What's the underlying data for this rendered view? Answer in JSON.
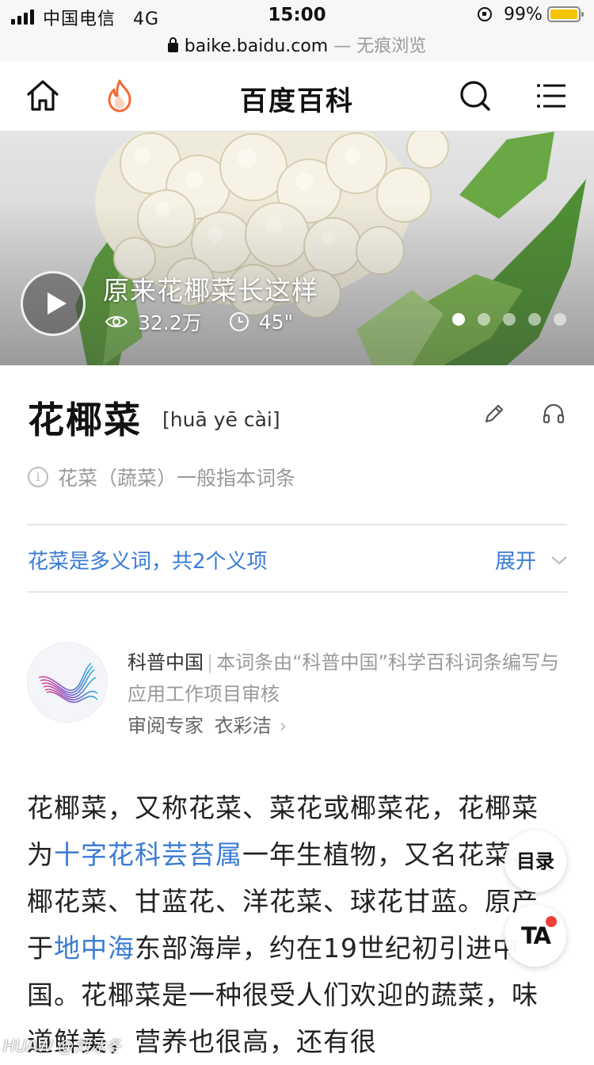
{
  "status_bar": {
    "carrier": "中国电信",
    "network": "4G",
    "time": "15:00",
    "battery": "99%"
  },
  "url_bar": {
    "domain": "baike.baidu.com",
    "mode": " — 无痕浏览"
  },
  "nav": {
    "title": "百度百科",
    "icons": [
      "home-icon",
      "hot-fire-icon",
      "search-icon",
      "menu-icon"
    ]
  },
  "hero": {
    "title": "原来花椰菜长这样",
    "views": "32.2万",
    "duration": "45\"",
    "slide_count": 5,
    "active_slide": 1
  },
  "entry": {
    "title": "花椰菜",
    "pinyin": "[huā yē cài]",
    "disambig_note": "花菜（蔬菜）一般指本词条",
    "polysemy": "花菜是多义词，共2个义项",
    "expand": "展开"
  },
  "expert": {
    "org": "科普中国",
    "separator": "|",
    "desc": "本词条由“科普中国”科学百科词条编写与应用工作项目审核",
    "reviewer_label": "审阅专家",
    "reviewer": "衣彩洁",
    "chevron": "›"
  },
  "body": {
    "p1_a": "花椰菜，又称花菜、菜花或椰菜花，花椰菜为",
    "p1_link1": "十字花科芸苔属",
    "p1_b": "一年生植物，又名花菜、椰花菜、甘蓝花、洋花菜、球花甘蓝。原产于",
    "p1_link2": "地中海",
    "p1_c": "东部海岸，约在19世纪初引进中国。花椰菜是一种很受人们欢迎的蔬菜，味道鲜美，营养也很高，还有很"
  },
  "floating": {
    "toc": "目录",
    "ta": "TA"
  },
  "watermark": "HUAW @刘冰冬"
}
